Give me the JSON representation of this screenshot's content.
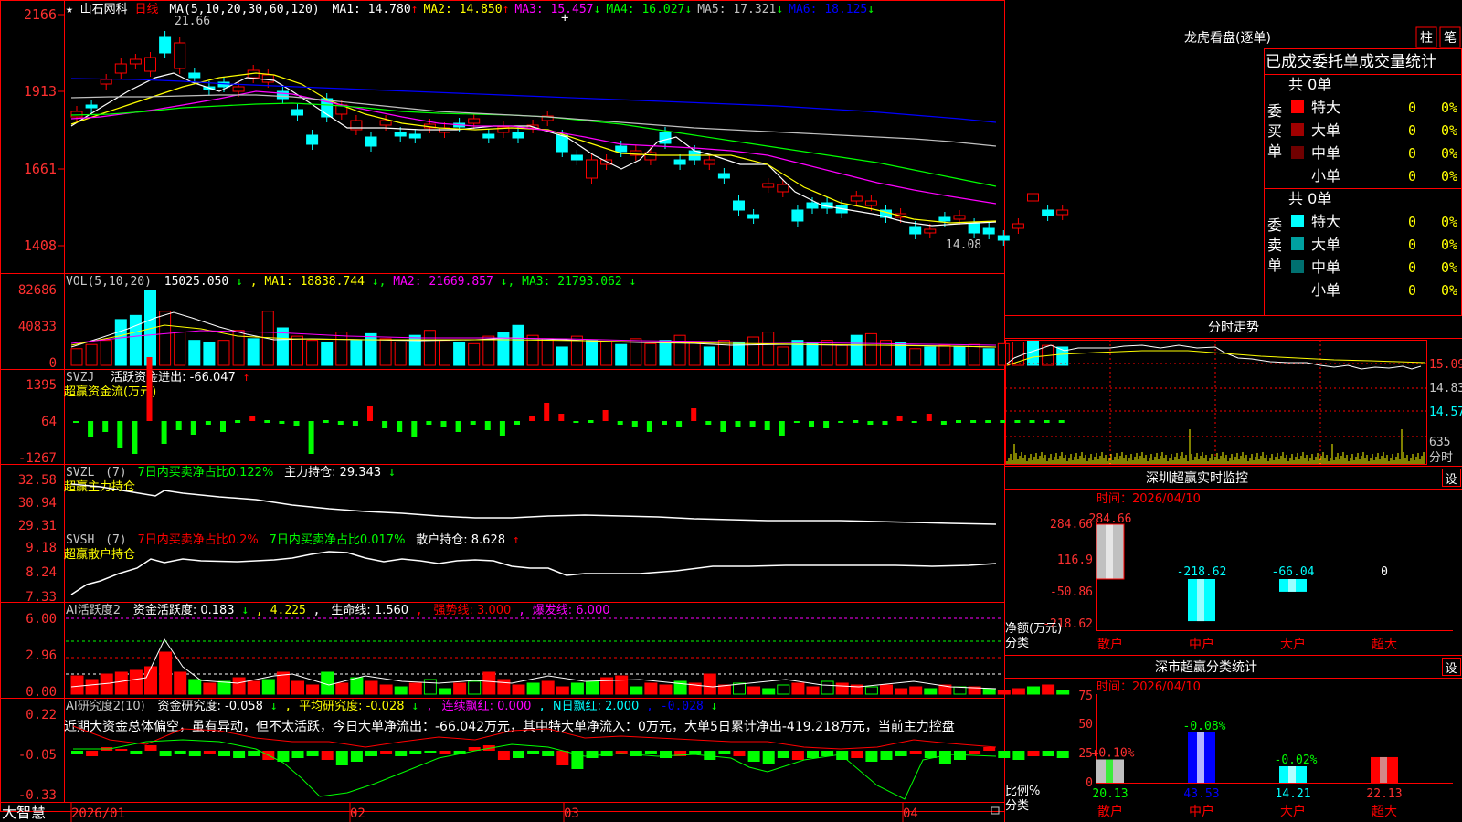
{
  "header": {
    "star": "★",
    "stock_name": "山石网科",
    "period": "日线",
    "ma_params": "MA(5,10,20,30,60,120)",
    "ma": [
      {
        "label": "MA1:",
        "value": "14.780",
        "arrow": "↑",
        "color": "#ffffff"
      },
      {
        "label": "MA2:",
        "value": "14.850",
        "arrow": "↑",
        "color": "#ffff00"
      },
      {
        "label": "MA3:",
        "value": "15.457",
        "arrow": "↓",
        "color": "#ff00ff"
      },
      {
        "label": "MA4:",
        "value": "16.027",
        "arrow": "↓",
        "color": "#00ff00"
      },
      {
        "label": "MA5:",
        "value": "17.321",
        "arrow": "↓",
        "color": "#c0c0c0"
      },
      {
        "label": "MA6:",
        "value": "18.125",
        "arrow": "↓",
        "color": "#0000ff"
      }
    ],
    "high_mark": "21.66",
    "low_mark": "14.08"
  },
  "price_axis": [
    "2166",
    "1913",
    "1661",
    "1408"
  ],
  "vol_pane": {
    "params": "VOL(5,10,20)",
    "value": "15025.050",
    "arrow": "↓",
    "ma1": "MA1: 18838.744",
    "ma2": "MA2: 21669.857",
    "ma3": "MA3: 21793.062",
    "axis": [
      "82686",
      "40833",
      "0"
    ],
    "bars": [
      20,
      25,
      30,
      55,
      60,
      90,
      65,
      40,
      30,
      28,
      30,
      42,
      32,
      65,
      45,
      35,
      30,
      28,
      40,
      30,
      38,
      32,
      28,
      36,
      42,
      30,
      28,
      26,
      35,
      40,
      48,
      36,
      32,
      22,
      35,
      30,
      28,
      25,
      32,
      26,
      30,
      36,
      28,
      22,
      30,
      28,
      34,
      40,
      22,
      30,
      28,
      30,
      24,
      36,
      38,
      30,
      28,
      20,
      22,
      24,
      22,
      25,
      20,
      26,
      28,
      30,
      24,
      22
    ],
    "colors": "RRRCCCRRCCRRCRCRRCRCCRRCRRCRRCCRRCRCRCRRCRRCRCRRRCCRRCRRCRCRCRCRRCR"
  },
  "svzj_pane": {
    "name": "SVZJ",
    "label": "活跃资金进出: -66.047",
    "arrow": "↑",
    "subtitle": "超赢资金流(万元)",
    "axis": [
      "1395",
      "64",
      "-1267"
    ],
    "values": [
      -2,
      -18,
      -12,
      -30,
      -36,
      70,
      -25,
      -10,
      -15,
      -4,
      -12,
      0,
      6,
      0,
      -3,
      -5,
      -36,
      0,
      -4,
      -5,
      16,
      -8,
      -12,
      -18,
      -4,
      -6,
      -12,
      -4,
      -10,
      -16,
      -4,
      6,
      20,
      8,
      -2,
      0,
      12,
      -4,
      -6,
      -12,
      -4,
      -6,
      14,
      -4,
      -12,
      -6,
      -6,
      -10,
      -16,
      -2,
      -6,
      -8,
      -2,
      0,
      -4,
      -4,
      6,
      -2,
      8,
      -4,
      0,
      0,
      0,
      0,
      0,
      0,
      0,
      0
    ],
    "pos_color": "#ff0000",
    "neg_color": "#00ff00"
  },
  "svzl_pane": {
    "name": "SVZL",
    "param": "(7)",
    "label1": "7日内买卖净占比0.122%",
    "label2": "主力持仓: 29.343",
    "arrow": "↓",
    "subtitle": "超赢主力持仓",
    "axis": [
      "32.58",
      "30.94",
      "29.31"
    ]
  },
  "svsh_pane": {
    "name": "SVSH",
    "param": "(7)",
    "label1": "7日内买卖净占比0.2%",
    "label2": "7日内买卖净占比0.017%",
    "label3": "散户持仓: 8.628",
    "arrow": "↑",
    "subtitle": "超赢散户持仓",
    "axis": [
      "9.18",
      "8.24",
      "7.33"
    ]
  },
  "ai_active_pane": {
    "name": "AI活跃度2",
    "label1": "资金活跃度: 0.183",
    "arrow1": "↓",
    "label2": "4.225",
    "label3": "生命线: 1.560",
    "label4": "强势线: 3.000",
    "label5": "爆发线: 6.000",
    "axis": [
      "6.00",
      "2.96",
      "0.00"
    ]
  },
  "ai_research_pane": {
    "name": "AI研究度2(10)",
    "label1": "资金研究度: -0.058",
    "arrow1": "↓",
    "label2": "平均研究度: -0.028",
    "arrow2": "↓",
    "label3": "连续飘红: 0.000",
    "label4": "N日飘红: 2.000",
    "label5": "-0.028",
    "arrow5": "↓",
    "commentary": "近期大资金总体偏空，虽有异动，但不太活跃，今日大单净流出：-66.042万元，其中特大单净流入：0万元，大单5日累计净出-419.218万元，当前主力控盘",
    "axis": [
      "0.22",
      "-0.05",
      "-0.33"
    ]
  },
  "date_axis": {
    "corner": "大智慧",
    "labels": [
      "2026/01",
      "02",
      "03",
      "04"
    ]
  },
  "dragon_panel": {
    "title": "龙虎看盘(逐单)",
    "btn_pillar": "柱",
    "btn_trade": "笔",
    "subtitle": "已成交委托单成交量统计",
    "buy_label": "委买单",
    "sell_label": "委卖单",
    "buy_total": "共 0单",
    "sell_total": "共 0单",
    "buy_rows": [
      {
        "color": "#ff0000",
        "name": "特大",
        "count": "0",
        "pct": "0%"
      },
      {
        "color": "#a00000",
        "name": "大单",
        "count": "0",
        "pct": "0%"
      },
      {
        "color": "#700000",
        "name": "中单",
        "count": "0",
        "pct": "0%"
      },
      {
        "color": "#000000",
        "name": "小单",
        "count": "0",
        "pct": "0%"
      }
    ],
    "sell_rows": [
      {
        "color": "#00ffff",
        "name": "特大",
        "count": "0",
        "pct": "0%"
      },
      {
        "color": "#00a0a0",
        "name": "大单",
        "count": "0",
        "pct": "0%"
      },
      {
        "color": "#007070",
        "name": "中单",
        "count": "0",
        "pct": "0%"
      },
      {
        "color": "#000000",
        "name": "小单",
        "count": "0",
        "pct": "0%"
      }
    ]
  },
  "intraday_panel": {
    "title": "分时走势",
    "axis": [
      "15.09",
      "14.83",
      "14.57",
      "635",
      "分时"
    ]
  },
  "sz_monitor": {
    "title": "深圳超赢实时监控",
    "settings": "设",
    "time": "时间：2026/04/10",
    "axis": [
      "284.66",
      "116.9",
      "-50.86",
      "-218.62"
    ],
    "ylabel": "净额(万元)",
    "xlabel": "分类",
    "bars": [
      {
        "name": "散户",
        "value": 284.66,
        "label": "284.66",
        "color": "#c0c0c0"
      },
      {
        "name": "中户",
        "value": -218.62,
        "label": "-218.62",
        "color": "#00ffff"
      },
      {
        "name": "大户",
        "value": -66.04,
        "label": "-66.04",
        "color": "#00ffff"
      },
      {
        "name": "超大",
        "value": 0,
        "label": "0",
        "color": "#ff0000"
      }
    ]
  },
  "sz_category": {
    "title": "深市超赢分类统计",
    "settings": "设",
    "time": "时间：2026/04/10",
    "axis": [
      "75",
      "50",
      "25",
      "0"
    ],
    "ylabel": "比例%",
    "xlabel": "分类",
    "bars": [
      {
        "name": "散户",
        "value": 20.13,
        "label": "20.13",
        "change": "+0.10%",
        "color": "#c0c0c0",
        "accent": "#00ff00"
      },
      {
        "name": "中户",
        "value": 43.53,
        "label": "43.53",
        "change": "-0.08%",
        "color": "#0000ff",
        "accent": "#ffffff"
      },
      {
        "name": "大户",
        "value": 14.21,
        "label": "14.21",
        "change": "-0.02%",
        "color": "#00ffff",
        "accent": "#ffffff"
      },
      {
        "name": "超大",
        "value": 22.13,
        "label": "22.13",
        "change": "",
        "color": "#ff0000",
        "accent": "#c0c0c0"
      }
    ]
  }
}
